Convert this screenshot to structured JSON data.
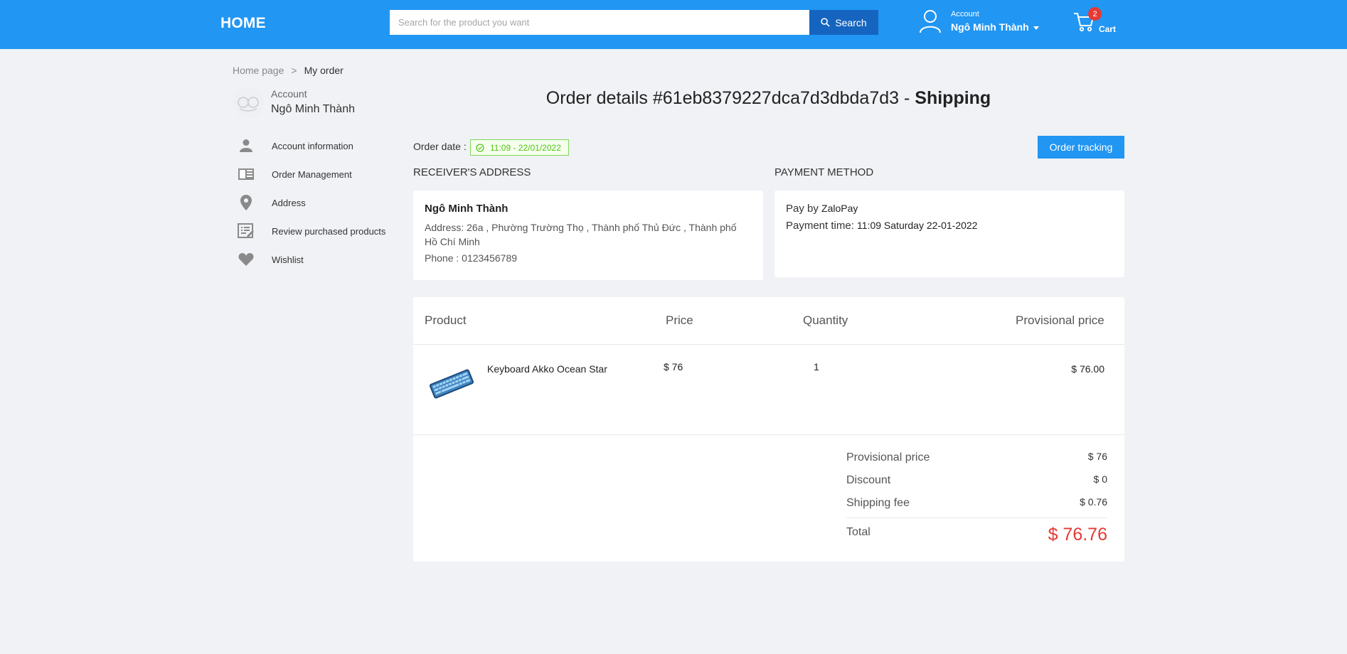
{
  "header": {
    "logo": "HOME",
    "search_placeholder": "Search for the product you want",
    "search_button": "Search",
    "account_label": "Account",
    "account_name": "Ngô Minh Thành",
    "cart_count": "2",
    "cart_label": "Cart"
  },
  "breadcrumb": {
    "home": "Home page",
    "separator": ">",
    "current": "My order"
  },
  "sidebar": {
    "account_label": "Account",
    "account_name": "Ngô Minh Thành",
    "items": [
      {
        "label": "Account information",
        "icon": "person-icon"
      },
      {
        "label": "Order Management",
        "icon": "book-icon"
      },
      {
        "label": "Address",
        "icon": "location-pin-icon"
      },
      {
        "label": "Review purchased products",
        "icon": "review-list-icon"
      },
      {
        "label": "Wishlist",
        "icon": "heart-icon"
      }
    ]
  },
  "order": {
    "title_prefix": "Order details #61eb8379227dca7d3dbda7d3 - ",
    "status": "Shipping",
    "date_label": "Order date :",
    "date_value": "11:09 - 22/01/2022",
    "tracking_button": "Order tracking"
  },
  "receiver": {
    "section_title": "RECEIVER'S ADDRESS",
    "name": "Ngô Minh Thành",
    "address": "Address: 26a , Phường Trường Thọ , Thành phố Thủ Đức , Thành phố Hồ Chí Minh",
    "phone": "Phone : 0123456789"
  },
  "payment": {
    "section_title": "PAYMENT METHOD",
    "pay_by_label": "Pay by",
    "pay_by_value": "ZaloPay",
    "time_label": "Payment time:",
    "time_value": "11:09 Saturday 22-01-2022"
  },
  "table": {
    "headers": [
      "Product",
      "Price",
      "Quantity",
      "Provisional price"
    ],
    "rows": [
      {
        "name": "Keyboard Akko Ocean Star",
        "price": "$ 76",
        "quantity": "1",
        "provisional": "$ 76.00"
      }
    ]
  },
  "summary": {
    "provisional_label": "Provisional price",
    "provisional_value": "$ 76",
    "discount_label": "Discount",
    "discount_value": "$ 0",
    "shipping_label": "Shipping fee",
    "shipping_value": "$ 0.76",
    "total_label": "Total",
    "total_value": "$ 76.76"
  },
  "colors": {
    "primary": "#2196f3",
    "search_button": "#1565c0",
    "total": "#e53935",
    "date_badge": "#52c41a"
  }
}
